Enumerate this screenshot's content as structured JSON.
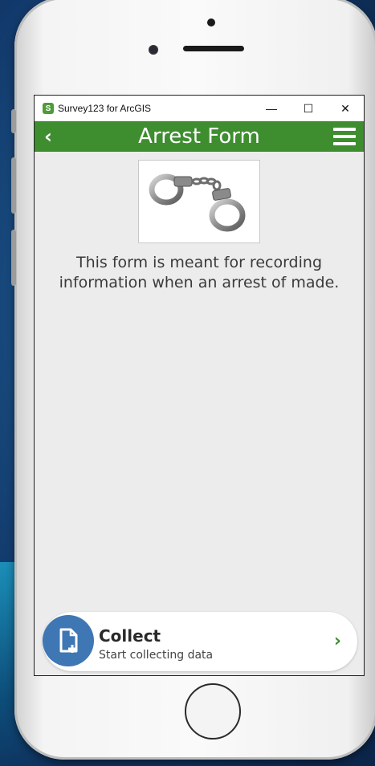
{
  "window": {
    "title": "Survey123 for ArcGIS",
    "app_icon_glyph": "S",
    "minimize": "—",
    "maximize": "☐",
    "close": "✕"
  },
  "header": {
    "back_glyph": "‹",
    "title": "Arrest Form",
    "menu_icon": "hamburger-menu-icon",
    "color": "#3e8e2f"
  },
  "form": {
    "image_alt": "handcuffs",
    "description": "This form is meant for recording information when an arrest of made."
  },
  "collect": {
    "title": "Collect",
    "subtitle": "Start collecting data",
    "chevron": "›",
    "icon": "new-document-icon",
    "icon_color": "#3f76b4"
  }
}
